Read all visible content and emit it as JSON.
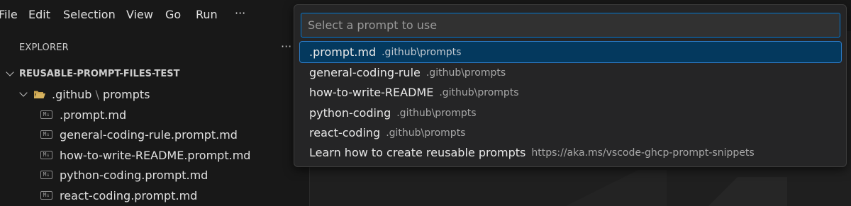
{
  "menubar": {
    "items": [
      "File",
      "Edit",
      "Selection",
      "View",
      "Go",
      "Run"
    ],
    "more": "···"
  },
  "sidebar": {
    "title": "EXPLORER",
    "more": "···",
    "root": "REUSABLE-PROMPT-FILES-TEST",
    "folder": {
      "part1": ".github",
      "sep": "\\",
      "part2": "prompts"
    },
    "file_icon_text": "M↓",
    "files": [
      ".prompt.md",
      "general-coding-rule.prompt.md",
      "how-to-write-README.prompt.md",
      "python-coding.prompt.md",
      "react-coding.prompt.md"
    ]
  },
  "quickpick": {
    "placeholder": "Select a prompt to use",
    "items": [
      {
        "label": ".prompt.md",
        "description": ".github\\prompts"
      },
      {
        "label": "general-coding-rule",
        "description": ".github\\prompts"
      },
      {
        "label": "how-to-write-README",
        "description": ".github\\prompts"
      },
      {
        "label": "python-coding",
        "description": ".github\\prompts"
      },
      {
        "label": "react-coding",
        "description": ".github\\prompts"
      },
      {
        "label": "Learn how to create reusable prompts",
        "description": "https://aka.ms/vscode-ghcp-prompt-snippets"
      }
    ]
  },
  "colors": {
    "accent": "#0078d4",
    "selection": "#04395e"
  }
}
